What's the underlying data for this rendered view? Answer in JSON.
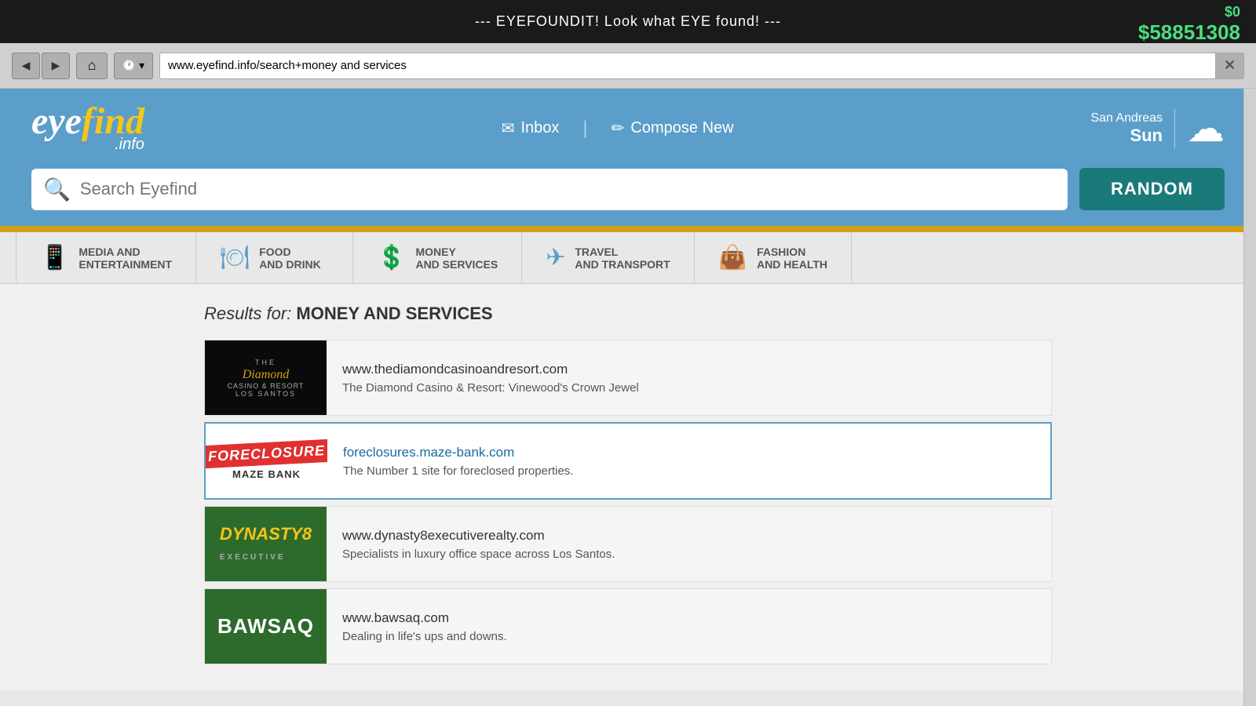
{
  "topBar": {
    "text": "--- EYEFOUNDIT! Look what EYE found! ---",
    "moneyTop": "$0",
    "moneyMain": "$58851308"
  },
  "browser": {
    "addressBar": "www.eyefind.info/search+money and services",
    "backBtn": "◀",
    "forwardBtn": "▶",
    "homeBtn": "⌂",
    "historyBtn": "🕐",
    "closeBtn": "✕"
  },
  "header": {
    "logoEye": "eye",
    "logoFind": "find",
    "logoDot": ".info",
    "inboxIcon": "✉",
    "inboxLabel": "Inbox",
    "composeIcon": "✏",
    "composeLabel": "Compose New",
    "weatherLocation": "San Andreas",
    "weatherCity": "Sun",
    "cloudIcon": "☁"
  },
  "search": {
    "placeholder": "Search Eyefind",
    "randomLabel": "RANDOM"
  },
  "categories": [
    {
      "icon": "📱",
      "line1": "MEDIA AND",
      "line2": "ENTERTAINMENT"
    },
    {
      "icon": "🍽",
      "line1": "FOOD",
      "line2": "AND DRINK"
    },
    {
      "icon": "💲",
      "line1": "MONEY",
      "line2": "AND SERVICES",
      "active": true
    },
    {
      "icon": "✈",
      "line1": "TRAVEL",
      "line2": "AND TRANSPORT"
    },
    {
      "icon": "👜",
      "line1": "FASHION",
      "line2": "AND HEALTH"
    }
  ],
  "results": {
    "header": "Results for: MONEY AND SERVICES",
    "items": [
      {
        "url": "www.thediamondcasinoandresort.com",
        "description": "The Diamond Casino & Resort: Vinewood's Crown Jewel",
        "thumb": "diamond",
        "highlighted": false
      },
      {
        "url": "foreclosures.maze-bank.com",
        "description": "The Number 1 site for foreclosed properties.",
        "thumb": "maze",
        "highlighted": true
      },
      {
        "url": "www.dynasty8executiverealty.com",
        "description": "Specialists in luxury office space across Los Santos.",
        "thumb": "dynasty",
        "highlighted": false
      },
      {
        "url": "www.bawsaq.com",
        "description": "Dealing in life's ups and downs.",
        "thumb": "bawsaq",
        "highlighted": false
      }
    ]
  }
}
